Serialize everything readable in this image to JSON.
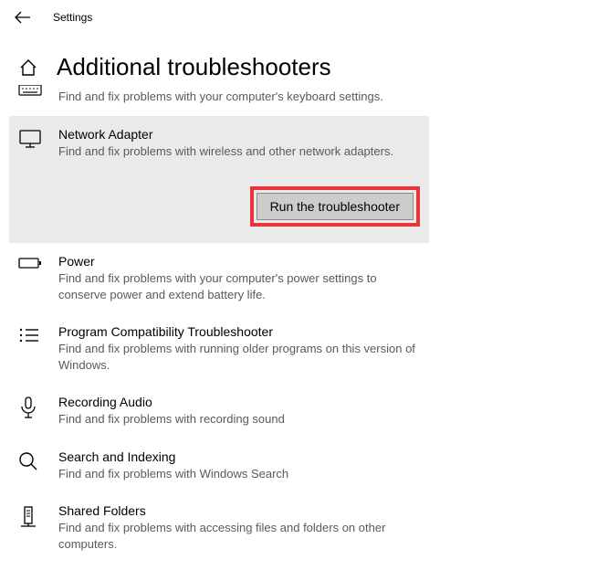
{
  "header": {
    "title": "Settings"
  },
  "page": {
    "title": "Additional troubleshooters"
  },
  "items": {
    "keyboard": {
      "desc": "Find and fix problems with your computer's keyboard settings."
    },
    "network": {
      "title": "Network Adapter",
      "desc": "Find and fix problems with wireless and other network adapters.",
      "run_label": "Run the troubleshooter"
    },
    "power": {
      "title": "Power",
      "desc": "Find and fix problems with your computer's power settings to conserve power and extend battery life."
    },
    "compat": {
      "title": "Program Compatibility Troubleshooter",
      "desc": "Find and fix problems with running older programs on this version of Windows."
    },
    "recording": {
      "title": "Recording Audio",
      "desc": "Find and fix problems with recording sound"
    },
    "search": {
      "title": "Search and Indexing",
      "desc": "Find and fix problems with Windows Search"
    },
    "shared": {
      "title": "Shared Folders",
      "desc": "Find and fix problems with accessing files and folders on other computers."
    }
  }
}
